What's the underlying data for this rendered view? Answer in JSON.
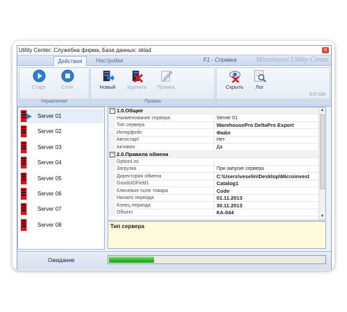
{
  "window": {
    "title": "Utility Center: Служебна фирма, База данных: sklad",
    "close_glyph": "✕"
  },
  "tabs": [
    {
      "label": "Действия",
      "active": true
    },
    {
      "label": "Настройки",
      "active": false
    }
  ],
  "help_label": "F1 - Справка",
  "brand": "Microinvest Utility Center",
  "ribbon": {
    "groups": [
      {
        "label": "Управление",
        "buttons": [
          {
            "label": "Старт",
            "icon": "play-icon",
            "disabled": true
          },
          {
            "label": "Стоп",
            "icon": "stop-icon",
            "disabled": true
          }
        ]
      },
      {
        "label": "Правка",
        "buttons": [
          {
            "label": "Новый",
            "icon": "new-server-icon",
            "disabled": false
          },
          {
            "label": "Удалить",
            "icon": "delete-icon",
            "disabled": true
          },
          {
            "label": "Правка",
            "icon": "edit-icon",
            "disabled": true
          }
        ]
      },
      {
        "label": "",
        "buttons": [
          {
            "label": "Скрыть",
            "icon": "hide-icon",
            "disabled": false
          },
          {
            "label": "Лог",
            "icon": "log-icon",
            "disabled": false
          }
        ]
      }
    ],
    "version": "3.07.029"
  },
  "servers": [
    {
      "label": "Server 01",
      "selected": true,
      "running": true
    },
    {
      "label": "Server 02",
      "selected": false,
      "running": false
    },
    {
      "label": "Server 03",
      "selected": false,
      "running": false
    },
    {
      "label": "Server 04",
      "selected": false,
      "running": false
    },
    {
      "label": "Server 05",
      "selected": false,
      "running": false
    },
    {
      "label": "Server 06",
      "selected": false,
      "running": false
    },
    {
      "label": "Server 07",
      "selected": false,
      "running": false
    },
    {
      "label": "Server 08",
      "selected": false,
      "running": false
    }
  ],
  "properties": {
    "categories": [
      {
        "title": "1.0.Общие",
        "toggle": "⊟",
        "rows": [
          {
            "key": "Наименование сервера",
            "value": "Server 01",
            "bold": false
          },
          {
            "key": "Тип сервера",
            "value": "WarehousePro DeltaPro Export",
            "bold": true
          },
          {
            "key": "Интерфейс",
            "value": "Файл",
            "bold": true
          },
          {
            "key": "Автостарт",
            "value": "Нет",
            "bold": false
          },
          {
            "key": "Активен",
            "value": "Да",
            "bold": false
          }
        ]
      },
      {
        "title": "2.0.Правила обмена",
        "toggle": "⊟",
        "rows": [
          {
            "key": "OptionList",
            "value": "",
            "bold": false
          },
          {
            "key": "Загрузка",
            "value": "При запуске сервера",
            "bold": false
          },
          {
            "key": "Директория обмена",
            "value": "C:\\Users\\veselin\\Desktop\\Microinvest",
            "bold": true
          },
          {
            "key": "GoodsIDField1",
            "value": "Catalog1",
            "bold": true
          },
          {
            "key": "Ключевое поле товара",
            "value": "Code",
            "bold": true
          },
          {
            "key": "Начало периода",
            "value": "01.11.2013",
            "bold": true
          },
          {
            "key": "Конец периода",
            "value": "30.11.2013",
            "bold": true
          },
          {
            "key": "Объект",
            "value": "КА-044",
            "bold": true
          }
        ]
      }
    ]
  },
  "description": {
    "title": "Тип сервера"
  },
  "status": {
    "text": "Ожидание",
    "progress": 0.21
  },
  "colors": {
    "accent": "#2a7fd4",
    "progress": "#2fb82f",
    "desc_bg": "#fefbdc",
    "server_red": "#d7191f"
  }
}
